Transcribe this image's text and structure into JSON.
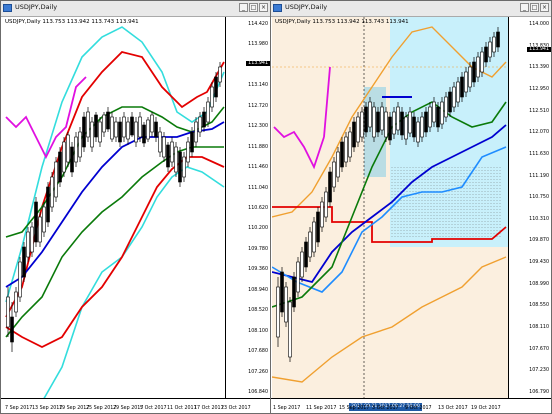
{
  "left": {
    "title": "USDJPY,Daily",
    "symline": "USDJPY,Daily  113.753 113.942 113.743 113.941",
    "price_badge": "113.941",
    "price_ticks": [
      "114.420",
      "113.980",
      "113.560",
      "113.140",
      "112.720",
      "112.300",
      "111.880",
      "111.460",
      "111.040",
      "110.620",
      "110.200",
      "109.780",
      "109.360",
      "108.940",
      "108.520",
      "108.100",
      "107.680",
      "107.260",
      "106.840"
    ],
    "date_ticks": [
      "7 Sep 2017",
      "13 Sep 2017",
      "19 Sep 2017",
      "25 Sep 2017",
      "29 Sep 2017",
      "5 Oct 2017",
      "11 Oct 2017",
      "17 Oct 2017",
      "23 Oct 2017"
    ]
  },
  "right": {
    "title": "USDJPY,Daily",
    "symline": "USDJPY,Daily  113.753 113.942 113.743 113.941",
    "price_badge": "113.941",
    "price_ticks": [
      "114.000",
      "113.830",
      "113.390",
      "112.950",
      "112.510",
      "112.070",
      "111.630",
      "111.190",
      "110.750",
      "110.310",
      "109.870",
      "109.430",
      "108.990",
      "108.550",
      "108.110",
      "107.670",
      "107.230",
      "106.790"
    ],
    "date_ticks": [
      "1 Sep 2017",
      "11 Sep 2017",
      "15 Sep 2017",
      "3 Oct 2017",
      "9 Oct 2017",
      "13 Oct 2017",
      "19 Oct 2017"
    ],
    "date_band": "2017.09.21 2017.09.27 00:00"
  },
  "colors": {
    "red": "#e30000",
    "cyan": "#33dddd",
    "green": "#0a7a0a",
    "blue": "#0000d0",
    "magenta": "#e010e0",
    "orange": "#f0a030",
    "ltblue": "#1e8cff",
    "cloud": "#c8f0fb",
    "tan": "#fbefdf"
  }
}
